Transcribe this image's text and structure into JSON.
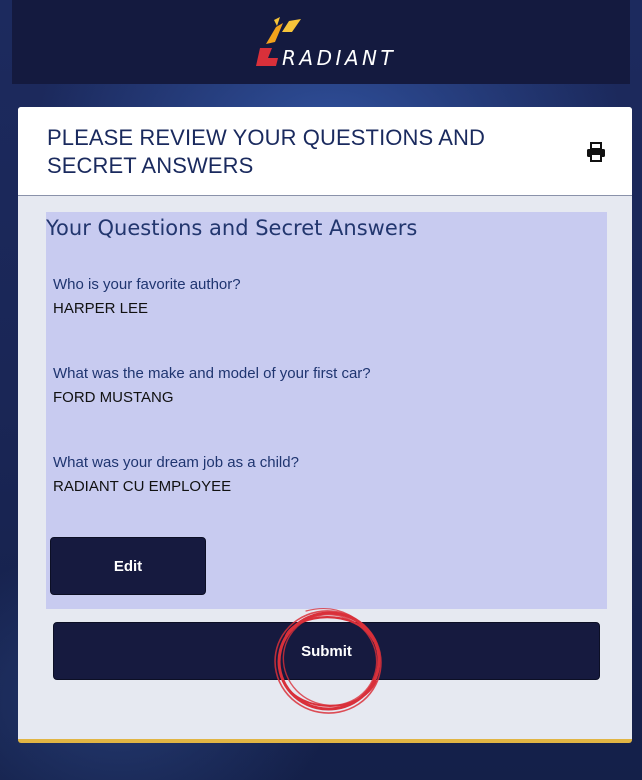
{
  "brand": {
    "name": "RADIANT"
  },
  "card": {
    "title_line1": "PLEASE REVIEW YOUR QUESTIONS AND",
    "title_line2": "SECRET ANSWERS",
    "print_icon": "printer-icon"
  },
  "qa": {
    "heading": "Your Questions and Secret Answers",
    "items": [
      {
        "question": "Who is your favorite author?",
        "answer": "HARPER LEE"
      },
      {
        "question": "What was the make and model of your first car?",
        "answer": "FORD MUSTANG"
      },
      {
        "question": "What was your dream job as a child?",
        "answer": "RADIANT CU EMPLOYEE"
      }
    ]
  },
  "buttons": {
    "edit": "Edit",
    "submit": "Submit"
  },
  "colors": {
    "navy": "#141a3f",
    "accent_yellow": "#e1b544",
    "accent_red": "#d9303a",
    "qa_background": "#c8cbf0"
  }
}
